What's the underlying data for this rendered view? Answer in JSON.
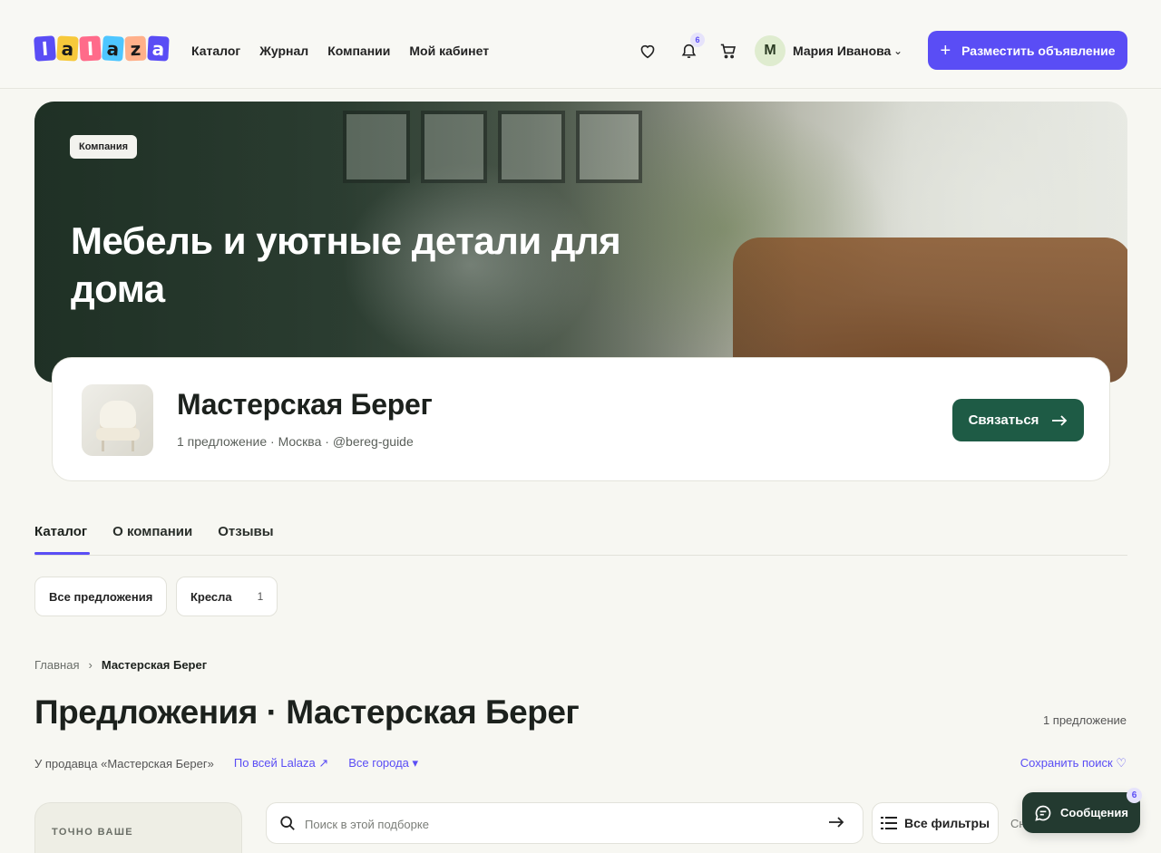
{
  "header": {
    "logo_letters": [
      "l",
      "a",
      "l",
      "a",
      "z",
      "a"
    ],
    "nav": [
      "Каталог",
      "Журнал",
      "Компании",
      "Мой кабинет"
    ],
    "notifications_count": "6",
    "avatar_initial": "М",
    "user_name": "Мария Иванова",
    "post_button": "Разместить объявление",
    "icons": [
      "heart-icon",
      "bell-icon",
      "cart-icon",
      "chevron-down-icon",
      "plus-icon"
    ]
  },
  "hero": {
    "badge": "Компания",
    "title": "Мебель и уютные детали для дома"
  },
  "company": {
    "name": "Мастерская Берег",
    "meta": "1 предложение · Москва · @bereg-guide",
    "contact_button": "Связаться"
  },
  "tabs": [
    "Каталог",
    "О компании",
    "Отзывы"
  ],
  "chips": [
    {
      "label": "Все предложения",
      "count": ""
    },
    {
      "label": "Кресла",
      "count": "1"
    }
  ],
  "breadcrumb": {
    "home": "Главная",
    "current": "Мастерская Берег"
  },
  "listing": {
    "title": "Предложения · Мастерская Берег",
    "count": "1 предложение",
    "seller_filter": "У продавца «Мастерская Берег»",
    "all_lalaza": "По всей Lalaza ↗",
    "cities": "Все города ▾",
    "save_search": "Сохранить поиск ♡"
  },
  "sidebar": {
    "label": "ТОЧНО ВАШЕ"
  },
  "search": {
    "placeholder": "Поиск в этой подборке"
  },
  "filters_button": "Все фильтры",
  "sort_peek": "Сн",
  "messages": {
    "label": "Сообщения",
    "count": "6"
  },
  "colors": {
    "accent": "#5a4df5",
    "brand_green": "#1e5b45",
    "chat_bg": "#233a30",
    "page_bg": "#f7f7f2"
  }
}
